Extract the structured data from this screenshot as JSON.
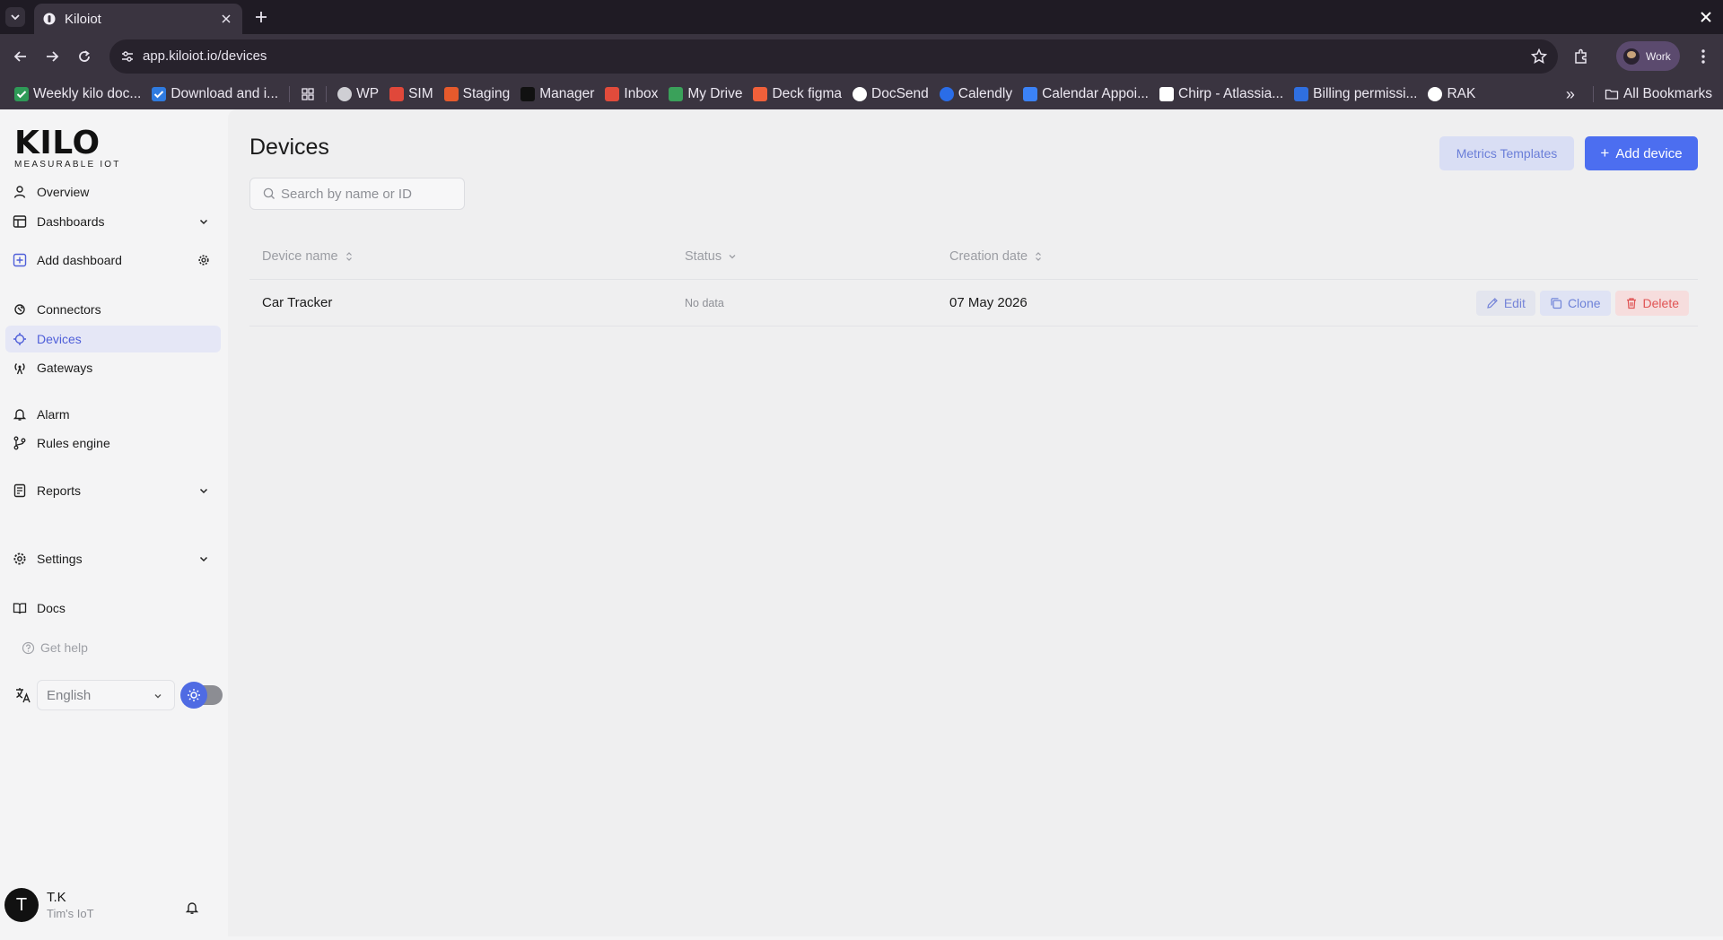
{
  "browser": {
    "tab_title": "Kiloiot",
    "url": "app.kiloiot.io/devices",
    "profile_label": "Work",
    "bookmarks": [
      {
        "label": "Weekly kilo doc...",
        "icon": "check-icon",
        "color": "#2e9a57"
      },
      {
        "label": "Download and i...",
        "icon": "check-icon",
        "color": "#2f7be0"
      },
      {
        "label": "WP",
        "icon": "wordpress-icon",
        "color": "#cfcfd4"
      },
      {
        "label": "SIM",
        "icon": "sim-icon",
        "color": "#e0483a"
      },
      {
        "label": "Staging",
        "icon": "staging-icon",
        "color": "#e65a2c"
      },
      {
        "label": "Manager",
        "icon": "manager-icon",
        "color": "#111111"
      },
      {
        "label": "Inbox",
        "icon": "gmail-icon",
        "color": "#e14b3b"
      },
      {
        "label": "My Drive",
        "icon": "drive-icon",
        "color": "#3aa15a"
      },
      {
        "label": "Deck figma",
        "icon": "figma-icon",
        "color": "#f0603a"
      },
      {
        "label": "DocSend",
        "icon": "docsend-icon",
        "color": "#ffffff"
      },
      {
        "label": "Calendly",
        "icon": "calendly-icon",
        "color": "#2a6de8"
      },
      {
        "label": "Calendar Appoi...",
        "icon": "calendar-icon",
        "color": "#3b82f6"
      },
      {
        "label": "Chirp - Atlassia...",
        "icon": "chirp-icon",
        "color": "#ffffff"
      },
      {
        "label": "Billing permissi...",
        "icon": "atlassian-icon",
        "color": "#2f6fe0"
      },
      {
        "label": "RAK",
        "icon": "rak-icon",
        "color": "#ffffff"
      }
    ],
    "all_bookmarks_label": "All Bookmarks"
  },
  "sidebar": {
    "logo_text": "KILO",
    "logo_subtitle": "MEASURABLE IOT",
    "items": {
      "overview": "Overview",
      "dashboards": "Dashboards",
      "add_dashboard": "Add dashboard",
      "connectors": "Connectors",
      "devices": "Devices",
      "gateways": "Gateways",
      "alarm": "Alarm",
      "rules_engine": "Rules engine",
      "reports": "Reports",
      "settings": "Settings",
      "docs": "Docs"
    },
    "get_help": "Get help",
    "language": "English",
    "user": {
      "initial": "T",
      "name": "T.K",
      "org": "Tim's IoT"
    }
  },
  "main": {
    "title": "Devices",
    "metrics_templates_label": "Metrics Templates",
    "add_device_label": "Add device",
    "search_placeholder": "Search by name or ID",
    "columns": {
      "device_name": "Device name",
      "status": "Status",
      "creation_date": "Creation date"
    },
    "rows": [
      {
        "name": "Car Tracker",
        "status": "No data",
        "created": "07 May 2026"
      }
    ],
    "actions": {
      "edit": "Edit",
      "clone": "Clone",
      "delete": "Delete"
    }
  },
  "colors": {
    "accent": "#4c6ef0",
    "active_nav_bg": "#e5e7f6",
    "danger": "#e05454"
  }
}
